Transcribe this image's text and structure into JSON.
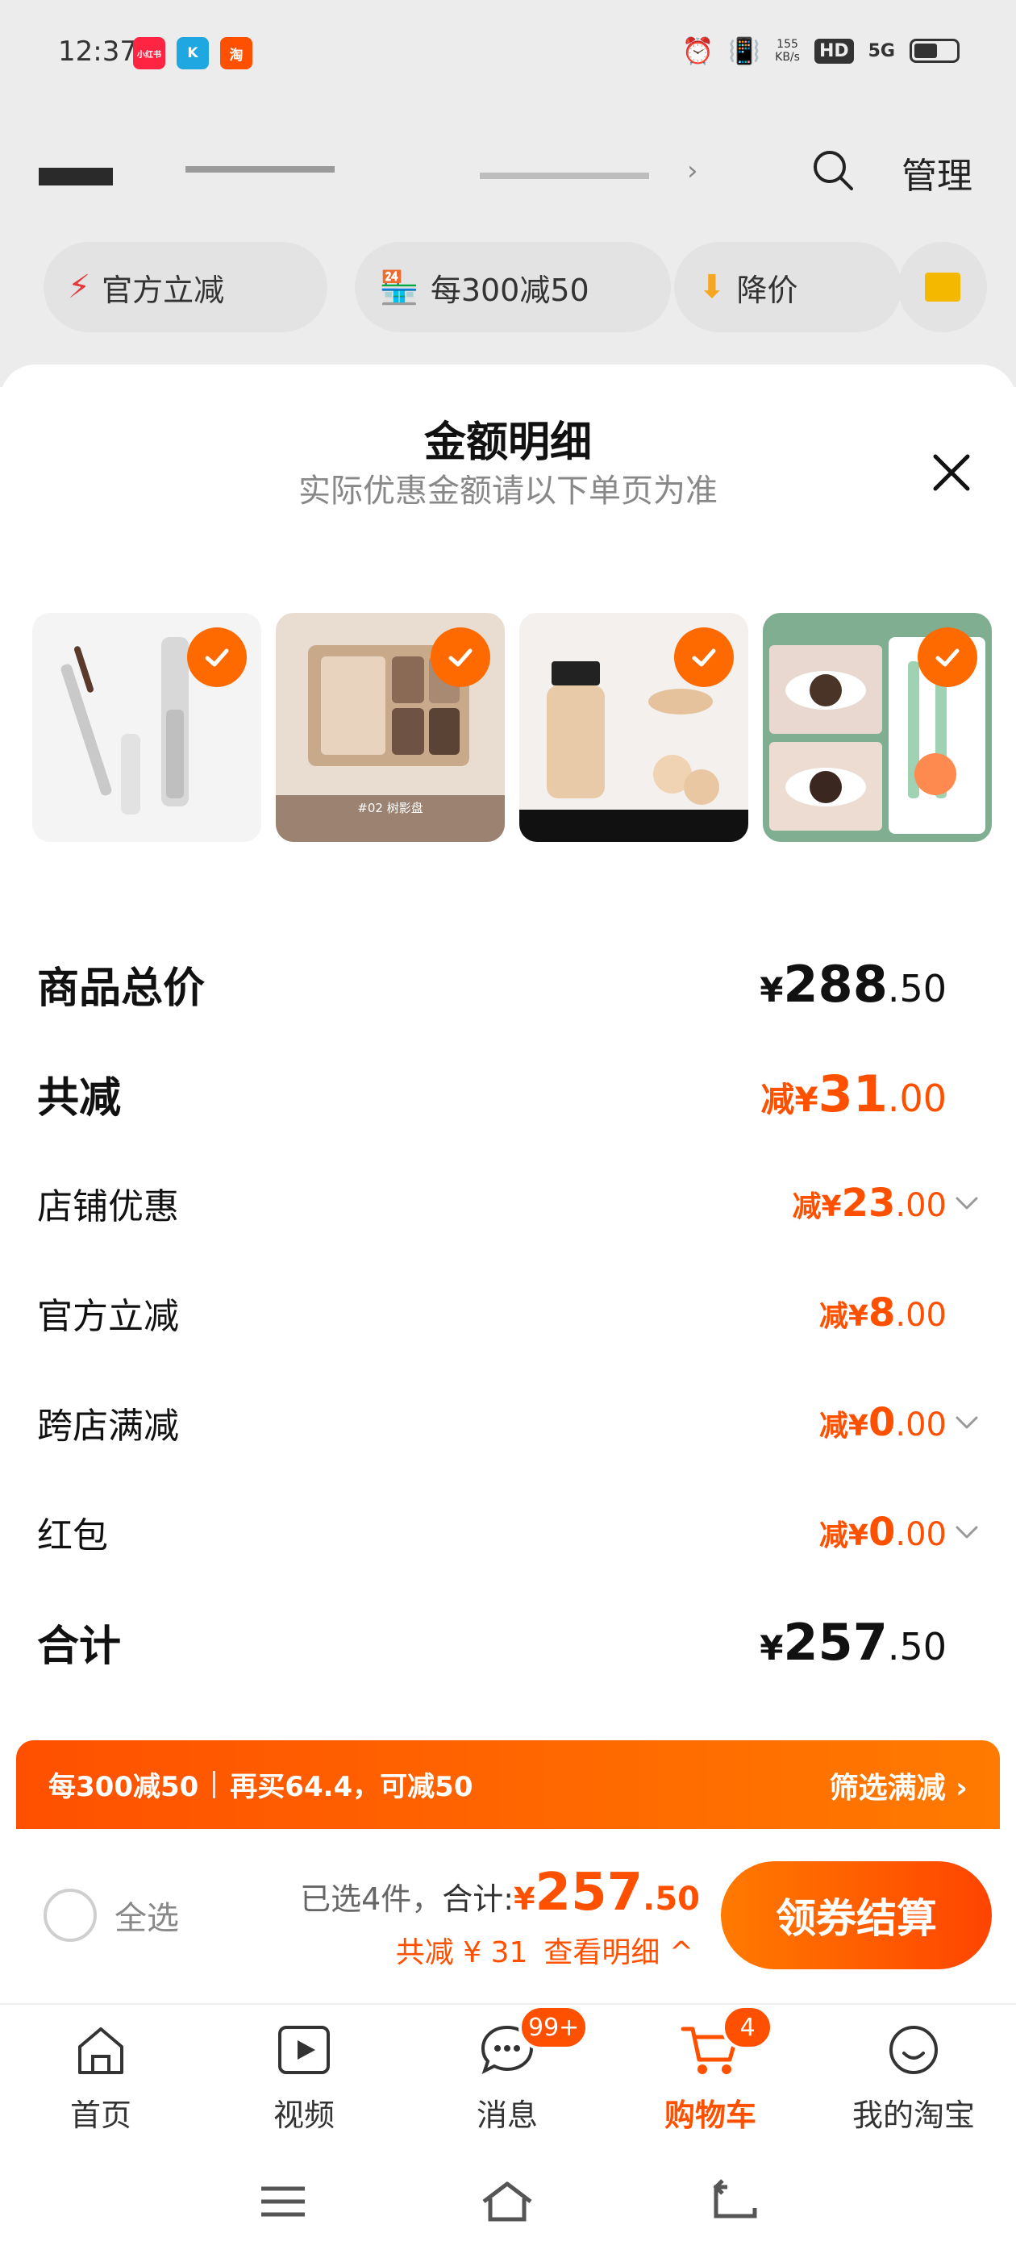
{
  "status_bar": {
    "time": "12:37",
    "apps": [
      {
        "icon": "xiaohongshu-app-icon",
        "text": "小红书",
        "color": "#ff2442"
      },
      {
        "icon": "k-app-icon",
        "text": "K",
        "color": "#1fa7e1"
      },
      {
        "icon": "taobao-app-icon",
        "text": "淘",
        "color": "#ff5000"
      }
    ],
    "net_speed_value": "155",
    "net_speed_unit": "KB/s",
    "hd_label": "HD",
    "signal_label": "5G"
  },
  "header": {
    "manage_label": "管理"
  },
  "filters": [
    {
      "label": "官方立减",
      "icon": "lightning-icon"
    },
    {
      "label": "每300减50",
      "icon": "shop-icon"
    },
    {
      "label": "降价",
      "icon": "arrow-down-icon"
    }
  ],
  "sheet": {
    "title": "金额明细",
    "subtitle": "实际优惠金额请以下单页为准",
    "thumbnails": [
      {
        "name": "mascara",
        "caption": ""
      },
      {
        "name": "eyeshadow-palette",
        "caption": "#02 树影盘"
      },
      {
        "name": "foundation",
        "caption": ""
      },
      {
        "name": "eyeliner",
        "caption": ""
      }
    ],
    "rows": [
      {
        "key": "total",
        "label": "商品总价",
        "prefix": "¥",
        "int": "288",
        "dec": ".50"
      },
      {
        "key": "discount",
        "label": "共减",
        "prefix": "减¥",
        "int": "31",
        "dec": ".00"
      },
      {
        "key": "shop",
        "label": "店铺优惠",
        "prefix": "减¥",
        "int": "23",
        "dec": ".00"
      },
      {
        "key": "official",
        "label": "官方立减",
        "prefix": "减¥",
        "int": "8",
        "dec": ".00"
      },
      {
        "key": "cross",
        "label": "跨店满减",
        "prefix": "减¥",
        "int": "0",
        "dec": ".00"
      },
      {
        "key": "redpacket",
        "label": "红包",
        "prefix": "减¥",
        "int": "0",
        "dec": ".00"
      },
      {
        "key": "sum",
        "label": "合计",
        "prefix": "¥",
        "int": "257",
        "dec": ".50"
      }
    ]
  },
  "promo": {
    "left_a": "每300减50",
    "left_b": "再买64.4，可减50",
    "right": "筛选满减 ›"
  },
  "checkout": {
    "select_all": "全选",
    "selected_count": "已选4件，",
    "total_label": "合计:",
    "total_prefix": "¥",
    "total_int": "257",
    "total_dec": ".50",
    "discount_text": "共减 ¥ 31",
    "details_link": "查看明细 ^",
    "button_label": "领券结算"
  },
  "tabbar": [
    {
      "label": "首页",
      "icon": "home-icon"
    },
    {
      "label": "视频",
      "icon": "video-icon"
    },
    {
      "label": "消息",
      "icon": "message-icon",
      "badge": "99+"
    },
    {
      "label": "购物车",
      "icon": "cart-icon",
      "badge": "4",
      "active": true
    },
    {
      "label": "我的淘宝",
      "icon": "profile-icon"
    }
  ],
  "colors": {
    "accent": "#ff5000",
    "accent_light": "#ff7a00"
  }
}
